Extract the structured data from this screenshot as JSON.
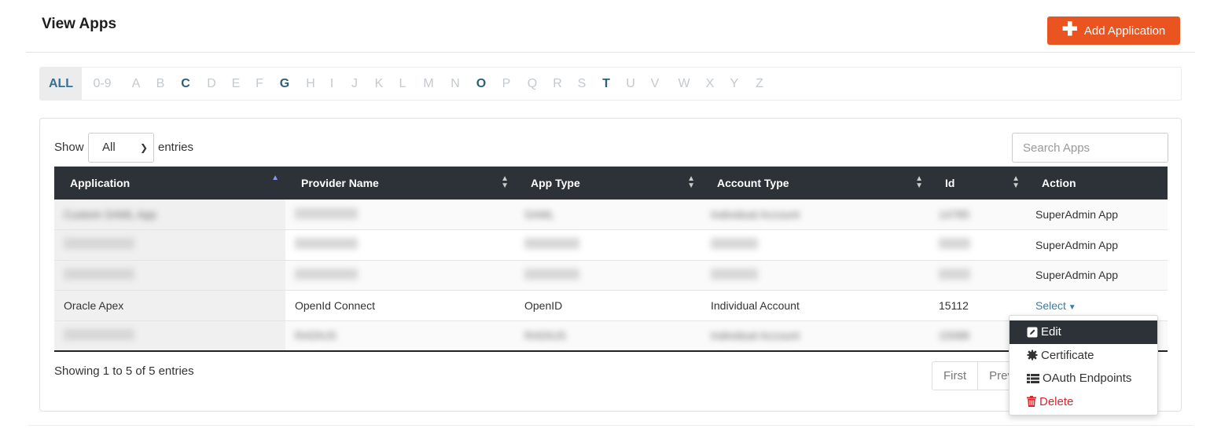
{
  "page": {
    "title": "View Apps"
  },
  "toolbar": {
    "add_label": "Add Application",
    "add_icon": "plus-icon",
    "accent": "#e95420"
  },
  "alphabet": {
    "letters": [
      {
        "label": "ALL",
        "state": "active"
      },
      {
        "label": "0-9",
        "state": "disabled"
      },
      {
        "label": "A",
        "state": "disabled"
      },
      {
        "label": "B",
        "state": "disabled"
      },
      {
        "label": "C",
        "state": "has"
      },
      {
        "label": "D",
        "state": "disabled"
      },
      {
        "label": "E",
        "state": "disabled"
      },
      {
        "label": "F",
        "state": "disabled"
      },
      {
        "label": "G",
        "state": "has"
      },
      {
        "label": "H",
        "state": "disabled"
      },
      {
        "label": "I",
        "state": "disabled"
      },
      {
        "label": "J",
        "state": "disabled"
      },
      {
        "label": "K",
        "state": "disabled"
      },
      {
        "label": "L",
        "state": "disabled"
      },
      {
        "label": "M",
        "state": "disabled"
      },
      {
        "label": "N",
        "state": "disabled"
      },
      {
        "label": "O",
        "state": "has"
      },
      {
        "label": "P",
        "state": "disabled"
      },
      {
        "label": "Q",
        "state": "disabled"
      },
      {
        "label": "R",
        "state": "disabled"
      },
      {
        "label": "S",
        "state": "disabled"
      },
      {
        "label": "T",
        "state": "has"
      },
      {
        "label": "U",
        "state": "disabled"
      },
      {
        "label": "V",
        "state": "disabled"
      },
      {
        "label": "W",
        "state": "disabled"
      },
      {
        "label": "X",
        "state": "disabled"
      },
      {
        "label": "Y",
        "state": "disabled"
      },
      {
        "label": "Z",
        "state": "disabled"
      }
    ]
  },
  "controls": {
    "show_label": "Show",
    "length_value": "All",
    "entries_label": "entries",
    "search_placeholder": "Search Apps"
  },
  "table": {
    "columns": [
      {
        "label": "Application",
        "sort": "asc"
      },
      {
        "label": "Provider Name",
        "sort": "both"
      },
      {
        "label": "App Type",
        "sort": "both"
      },
      {
        "label": "Account Type",
        "sort": "both"
      },
      {
        "label": "Id",
        "sort": "both"
      },
      {
        "label": "Action",
        "sort": "none"
      }
    ],
    "rows": [
      {
        "cells": [
          "Custom SAML App",
          "",
          "SAML",
          "Individual Account",
          "14785"
        ],
        "action": "SuperAdmin App",
        "obscured": true
      },
      {
        "cells": [
          "",
          "",
          "",
          "",
          ""
        ],
        "action": "SuperAdmin App",
        "obscured": true
      },
      {
        "cells": [
          "",
          "",
          "",
          "",
          ""
        ],
        "action": "SuperAdmin App",
        "obscured": true
      },
      {
        "cells": [
          "Oracle Apex",
          "OpenId Connect",
          "OpenID",
          "Individual Account",
          "15112"
        ],
        "action": "Select",
        "obscured": false
      },
      {
        "cells": [
          "",
          "RADIUS",
          "RADIUS",
          "Individual Account",
          "15088"
        ],
        "action": "",
        "obscured": true
      }
    ]
  },
  "footer": {
    "showing": "Showing 1 to 5 of 5 entries",
    "pager": [
      "First",
      "Prev"
    ]
  },
  "dropdown": {
    "items": [
      {
        "label": "Edit",
        "icon": "edit-icon"
      },
      {
        "label": "Certificate",
        "icon": "certificate-icon"
      },
      {
        "label": "OAuth Endpoints",
        "icon": "list-icon"
      },
      {
        "label": "Delete",
        "icon": "trash-icon"
      }
    ]
  }
}
